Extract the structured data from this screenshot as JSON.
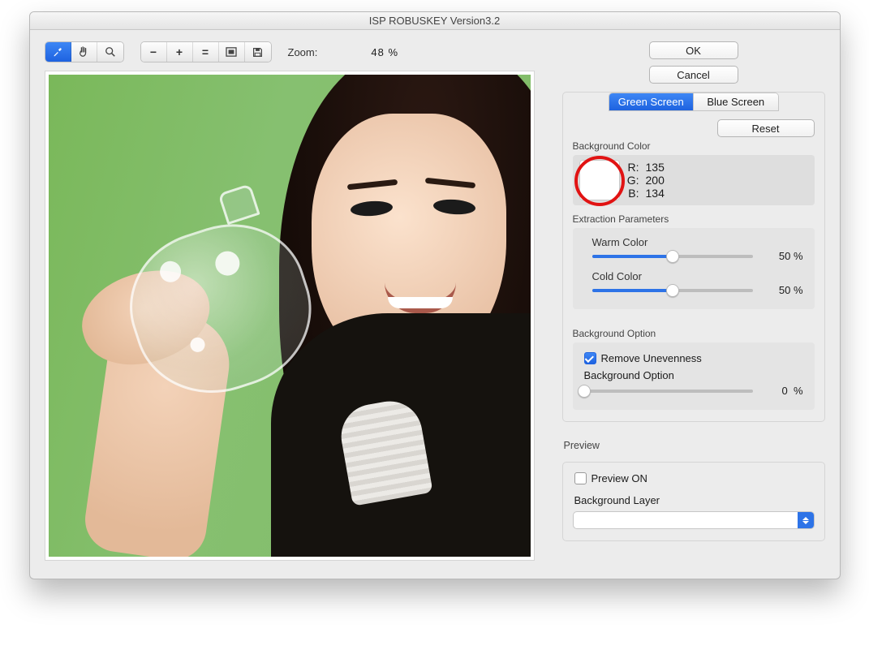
{
  "window": {
    "title": "ISP ROBUSKEY Version3.2"
  },
  "toolbar": {
    "tool_eyedropper": "eyedropper",
    "tool_hand": "hand",
    "tool_zoom": "zoom",
    "zoom_out": "−",
    "zoom_in": "+",
    "zoom_fit": "=",
    "zoom_actual": "[ ]",
    "zoom_save": "💾",
    "zoom_label": "Zoom:",
    "zoom_value": "48",
    "zoom_unit": "%"
  },
  "actions": {
    "ok": "OK",
    "cancel": "Cancel",
    "reset": "Reset"
  },
  "tabs": {
    "green": "Green Screen",
    "blue": "Blue Screen"
  },
  "bgcolor": {
    "section": "Background Color",
    "r_label": "R:",
    "r": "135",
    "g_label": "G:",
    "g": "200",
    "b_label": "B:",
    "b": "134",
    "swatch": "#ffffff"
  },
  "extract": {
    "section": "Extraction Parameters",
    "warm_label": "Warm Color",
    "warm_value": "50",
    "warm_unit": "%",
    "cold_label": "Cold Color",
    "cold_value": "50",
    "cold_unit": "%"
  },
  "bgopt": {
    "section": "Background Option",
    "remove_label": "Remove Unevenness",
    "remove_checked": true,
    "slider_label": "Background Option",
    "value": "0",
    "unit": "%"
  },
  "preview": {
    "section": "Preview",
    "on_label": "Preview ON",
    "on_checked": false,
    "layer_label": "Background Layer",
    "layer_value": ""
  }
}
